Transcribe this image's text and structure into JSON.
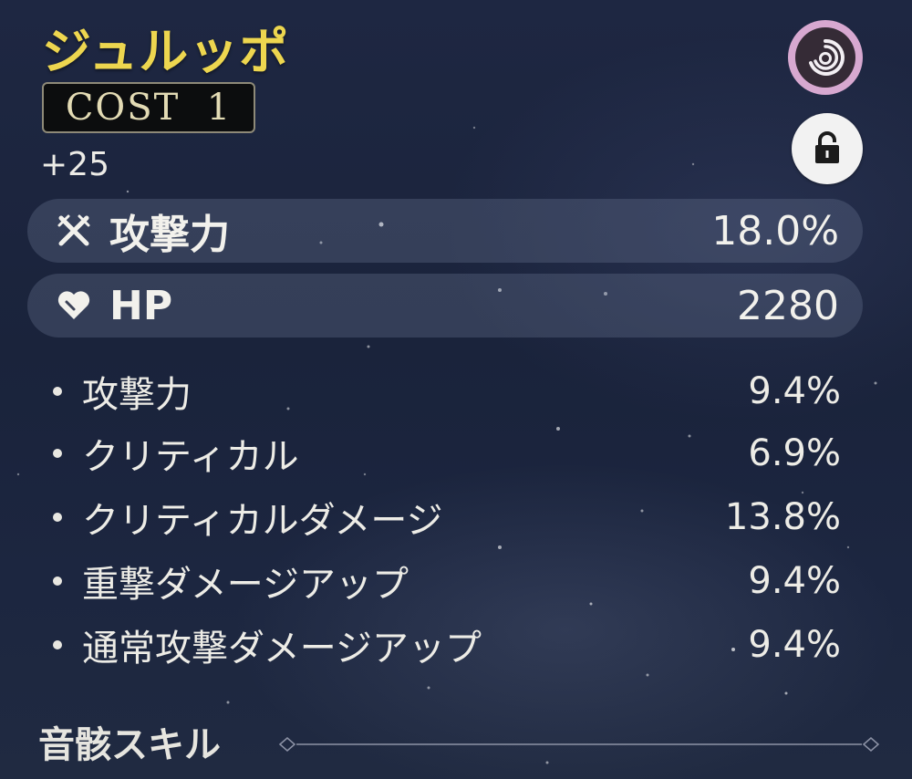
{
  "echo": {
    "name": "ジュルッポ",
    "cost_label": "COST  1",
    "level": "+25"
  },
  "icons": {
    "sonata": "sonata-swirl-icon",
    "lock": "unlock-icon",
    "main_stat_1": "crossed-swords-icon",
    "main_stat_2": "heart-icon"
  },
  "main_stats": [
    {
      "name": "攻撃力",
      "value": "18.0%"
    },
    {
      "name": "HP",
      "value": "2280"
    }
  ],
  "sub_stats": [
    {
      "name": "攻撃力",
      "value": "9.4%"
    },
    {
      "name": "クリティカル",
      "value": "6.9%"
    },
    {
      "name": "クリティカルダメージ",
      "value": "13.8%"
    },
    {
      "name": "重撃ダメージアップ",
      "value": "9.4%"
    },
    {
      "name": "通常攻撃ダメージアップ",
      "value": "9.4%"
    }
  ],
  "section": {
    "title": "音骸スキル"
  },
  "colors": {
    "title": "#EDD64F",
    "sonata_ring": "#D7A8D0",
    "background": "#1C2540"
  }
}
